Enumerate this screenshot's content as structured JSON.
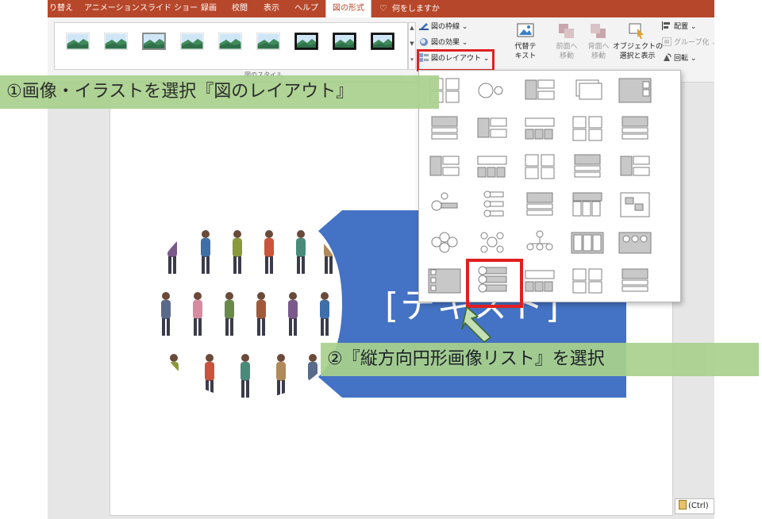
{
  "tabs": [
    "り替え",
    "アニメーション",
    "スライド ショー",
    "録画",
    "校閲",
    "表示",
    "ヘルプ",
    "図の形式"
  ],
  "active_tab": "図の形式",
  "tell_me": "何をしますか",
  "ribbon": {
    "group_label": "図のスタイル",
    "picture_border": "図の枠線",
    "picture_effects": "図の効果",
    "picture_layout": "図のレイアウト",
    "alt_text": "代替テ\nキスト",
    "bring_forward": "前面へ\n移動",
    "send_backward": "背面へ\n移動",
    "selection_pane": "オブジェクトの\n選択と表示",
    "align": "配置",
    "group": "グループ化",
    "rotate": "回転",
    "style_thumbnails": [
      "simple-frame",
      "soft-edge",
      "shadow-frame",
      "rounded-white",
      "reflected",
      "reflected-soft",
      "black-frame",
      "thick-black",
      "bevel-frame"
    ]
  },
  "slide": {
    "shape_text": "[テキスト]"
  },
  "dropdown": {
    "layouts": [
      "bending-picture-caption-list",
      "circular-picture-callout",
      "picture-grid",
      "picture-frame",
      "snapshot-picture-list",
      "bending-picture-accent",
      "title-picture-blocks",
      "picture-caption-list",
      "bending-picture-blocks",
      "picture-accent-blocks",
      "alternating-picture-blocks",
      "picture-lineup",
      "framed-text-picture",
      "picture-accent-list",
      "picture-organization",
      "bubble-picture-list",
      "vertical-circle-list-small",
      "titled-picture-blocks",
      "titled-picture-accent",
      "circle-picture-hierarchy",
      "hexagon-cluster",
      "circle-picture-cycle",
      "picture-org-chart",
      "ascending-picture-blocks",
      "accent-picture-slides",
      "horizontal-picture-list",
      "vertical-circle-picture-list",
      "picture-table",
      "vertical-picture-list",
      "spiral-picture"
    ],
    "selected_index": 26
  },
  "paste_options": "(Ctrl)",
  "annotations": {
    "step1": "①画像・イラストを選択『図のレイアウト』",
    "step2": "②『縦方向円形画像リスト』を選択"
  },
  "colors": {
    "tab_bar": "#b7472a",
    "shape_fill": "#4472c4",
    "note_fill": "#a9d18e",
    "highlight": "#e02020",
    "arrow_fill": "#c5e0b4"
  }
}
